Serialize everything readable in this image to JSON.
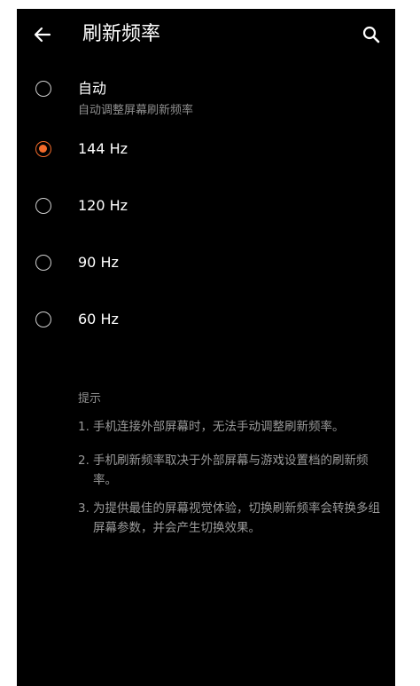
{
  "header": {
    "title": "刷新频率",
    "back_icon": "arrow-left-icon",
    "search_icon": "search-icon"
  },
  "options": [
    {
      "label": "自动",
      "sublabel": "自动调整屏幕刷新频率",
      "selected": false
    },
    {
      "label": "144 Hz",
      "selected": true
    },
    {
      "label": "120 Hz",
      "selected": false
    },
    {
      "label": "90 Hz",
      "selected": false
    },
    {
      "label": "60 Hz",
      "selected": false
    }
  ],
  "tips": {
    "heading": "提示",
    "items": [
      {
        "num": "1.",
        "text": "手机连接外部屏幕时，无法手动调整刷新频率。"
      },
      {
        "num": "2.",
        "text": "手机刷新频率取决于外部屏幕与游戏设置档的刷新频率。"
      },
      {
        "num": "3.",
        "text": "为提供最佳的屏幕视觉体验，切换刷新频率会转换多组屏幕参数，并会产生切换效果。"
      }
    ]
  },
  "colors": {
    "background": "#000000",
    "accent": "#f36b2b",
    "text_primary": "#ffffff",
    "text_secondary": "#8f8f8f"
  }
}
